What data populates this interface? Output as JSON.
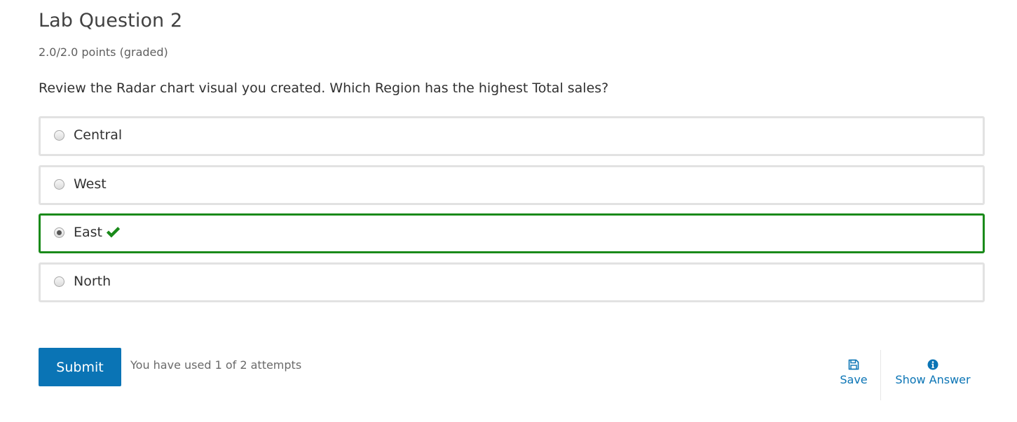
{
  "problem": {
    "title": "Lab Question 2",
    "points": "2.0/2.0 points (graded)",
    "prompt": "Review the Radar chart visual you created. Which Region has the highest Total sales?"
  },
  "choices": [
    {
      "label": "Central",
      "selected": false,
      "correct": false
    },
    {
      "label": "West",
      "selected": false,
      "correct": false
    },
    {
      "label": "East",
      "selected": true,
      "correct": true
    },
    {
      "label": "North",
      "selected": false,
      "correct": false
    }
  ],
  "actions": {
    "submit_label": "Submit",
    "attempts_text": "You have used 1 of 2 attempts",
    "save_label": "Save",
    "save_icon": "floppy-disk-icon",
    "show_answer_label": "Show Answer",
    "show_answer_icon": "info-circle-icon"
  },
  "colors": {
    "accent": "#0a74b5",
    "correct": "#1a8a1a",
    "border": "#e2e2e2"
  }
}
